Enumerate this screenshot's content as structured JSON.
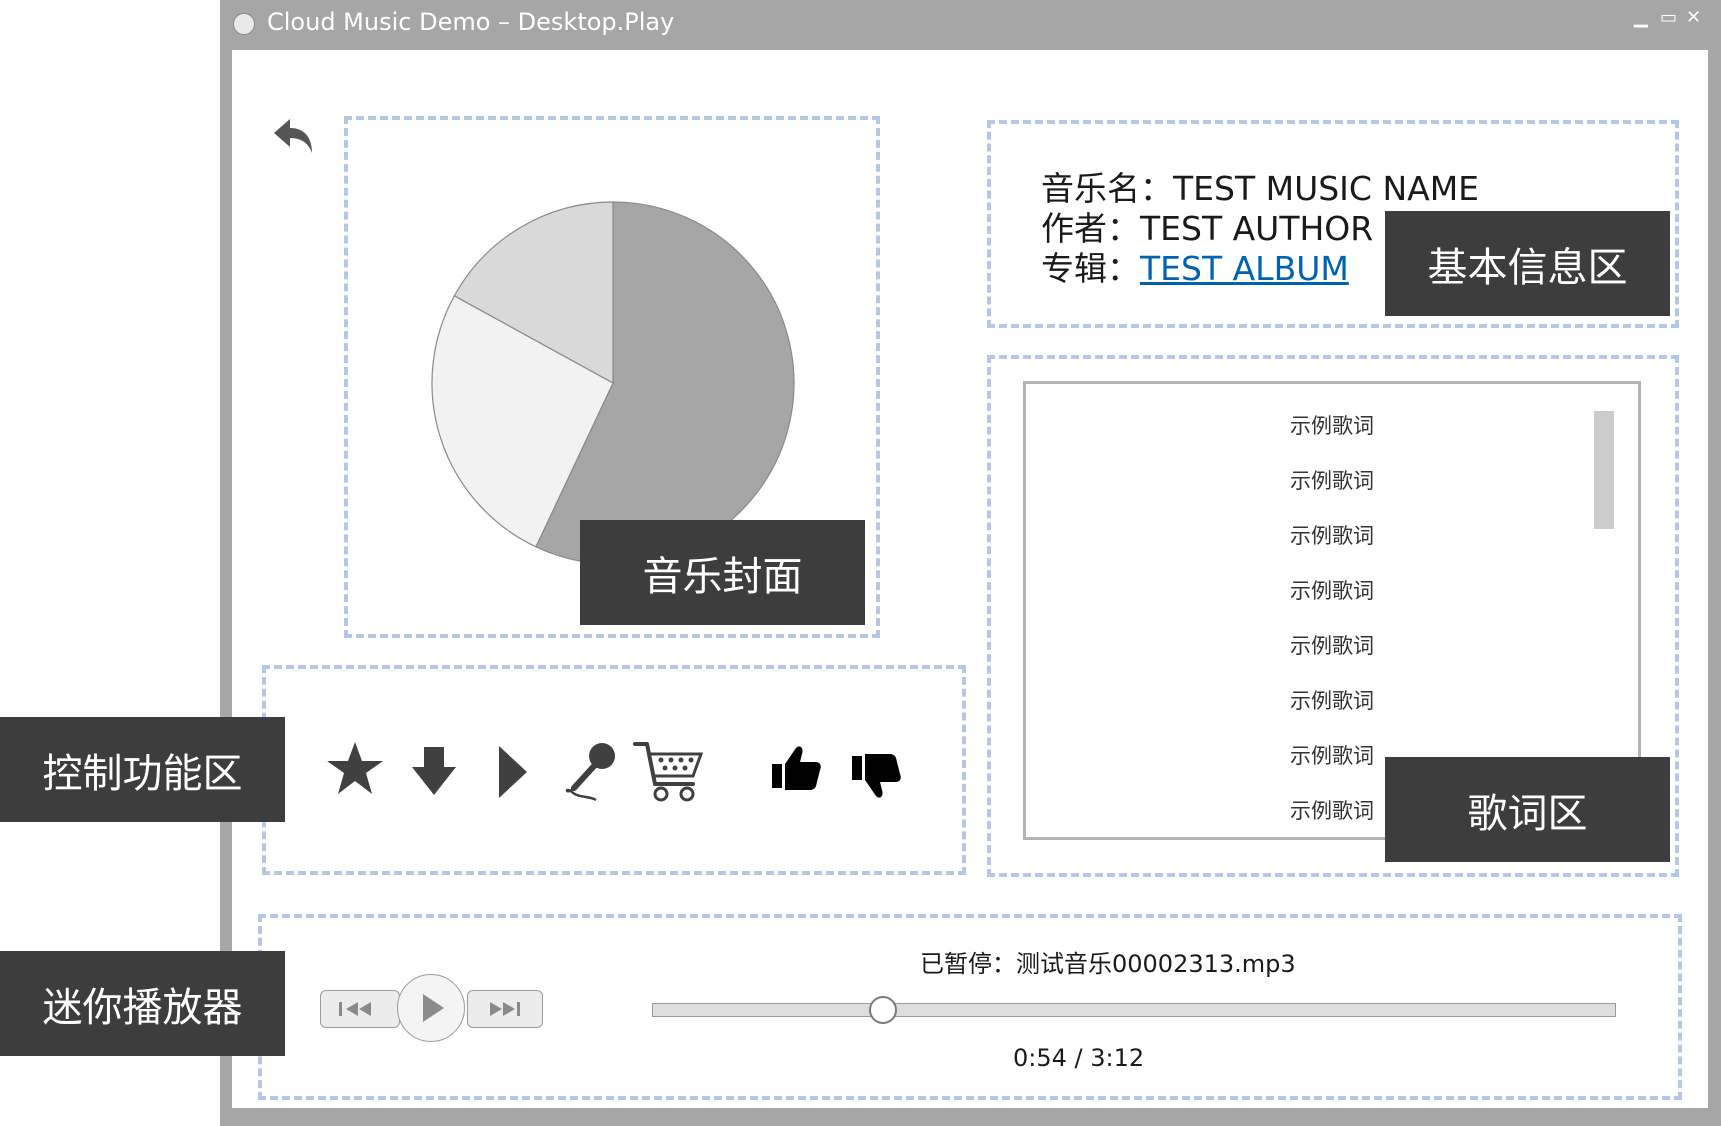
{
  "window": {
    "title": "Cloud Music Demo – Desktop.Play",
    "minimize_glyph": "▁",
    "maximize_glyph": "▭",
    "close_glyph": "✕"
  },
  "annotations": {
    "cover": "音乐封面",
    "info": "基本信息区",
    "lyrics": "歌词区",
    "control": "控制功能区",
    "mini_player": "迷你播放器"
  },
  "cover": {
    "icon": "pie-chart-placeholder",
    "slices": [
      {
        "value": 0.57,
        "color": "#a6a6a6"
      },
      {
        "value": 0.26,
        "color": "#f2f2f2"
      },
      {
        "value": 0.17,
        "color": "#d9d9d9"
      }
    ]
  },
  "info": {
    "music_label": "音乐名：",
    "music_name": "TEST MUSIC NAME",
    "author_label": "作者：",
    "author_name": "TEST AUTHOR",
    "album_label": "专辑：",
    "album_name": "TEST ALBUM"
  },
  "lyrics": {
    "lines": [
      "示例歌词",
      "示例歌词",
      "示例歌词",
      "示例歌词",
      "示例歌词",
      "示例歌词",
      "示例歌词",
      "示例歌词"
    ]
  },
  "controls": {
    "icons": [
      "star-icon",
      "download-icon",
      "play-icon",
      "microphone-icon",
      "cart-icon",
      "thumbs-up-icon",
      "thumbs-down-icon"
    ]
  },
  "mini_player": {
    "status": "已暂停：测试音乐00002313.mp3",
    "time": "0:54 / 3:12",
    "progress": 0.24,
    "prev_glyph": "I◀◀",
    "next_glyph": "▶▶I"
  },
  "colors": {
    "frame": "#a6a6a6",
    "dash": "#b4c7e7",
    "tag_bg": "#3d3d3d",
    "link": "#0063b1"
  }
}
